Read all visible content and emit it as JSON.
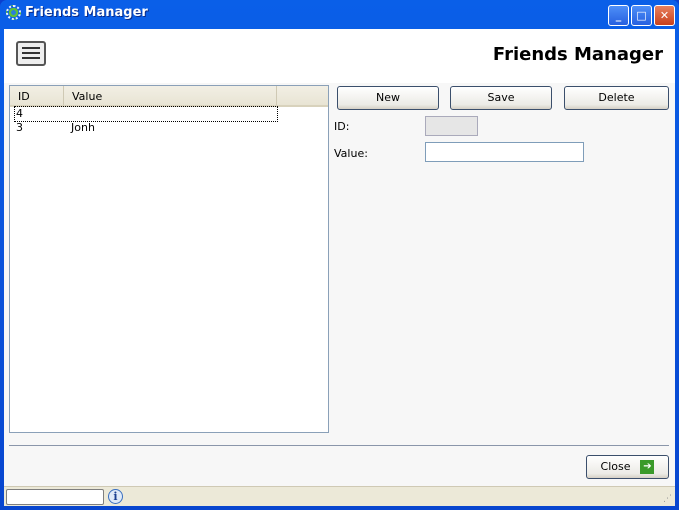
{
  "window": {
    "title": "Friends Manager"
  },
  "header": {
    "title": "Friends Manager"
  },
  "grid": {
    "columns": [
      "ID",
      "Value"
    ],
    "rows": [
      {
        "id": "4",
        "value": ""
      },
      {
        "id": "3",
        "value": "Jonh"
      }
    ]
  },
  "toolbar": {
    "new": "New",
    "save": "Save",
    "delete": "Delete"
  },
  "form": {
    "id_label": "ID:",
    "id_value": "",
    "value_label": "Value:",
    "value_value": ""
  },
  "footer": {
    "close": "Close"
  },
  "status": {
    "text": ""
  }
}
